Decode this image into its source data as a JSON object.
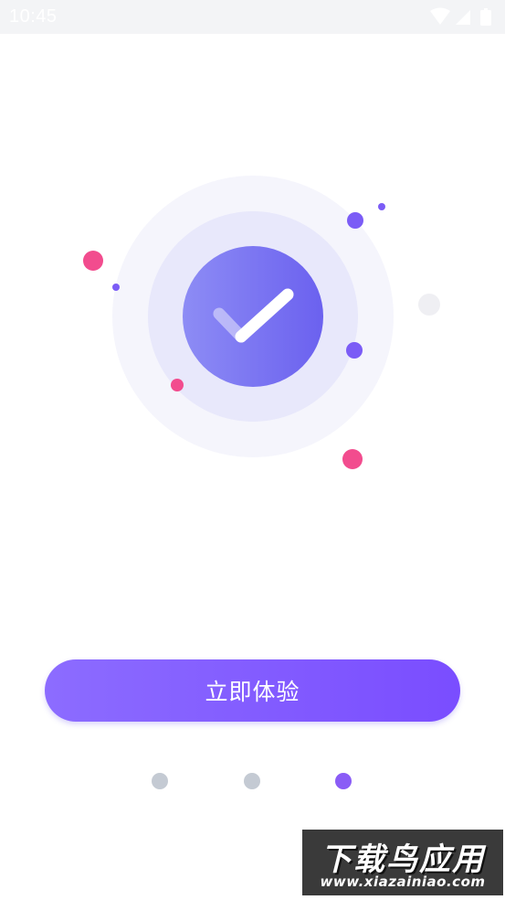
{
  "status_bar": {
    "time": "10:45",
    "icons": [
      "wifi-icon",
      "cellular-signal-icon",
      "battery-icon"
    ]
  },
  "illustration": {
    "icon": "checkmark-icon",
    "colors": {
      "outer_ring": "#f5f5fc",
      "inner_ring": "#e8e8fb",
      "disc_start": "#8d8cf5",
      "disc_end": "#6b61ef",
      "pink": "#f24c8e",
      "purple": "#7b5cf6",
      "gray": "#efeff3"
    }
  },
  "cta": {
    "label": "立即体验",
    "color_start": "#8c6cff",
    "color_end": "#7a4dff"
  },
  "page_indicator": {
    "count": 3,
    "active_index": 2,
    "active_color": "#8a5cf6",
    "inactive_color": "#c4cad3"
  },
  "watermark": {
    "title": "下载鸟应用",
    "url": "www.xiazainiao.com"
  }
}
